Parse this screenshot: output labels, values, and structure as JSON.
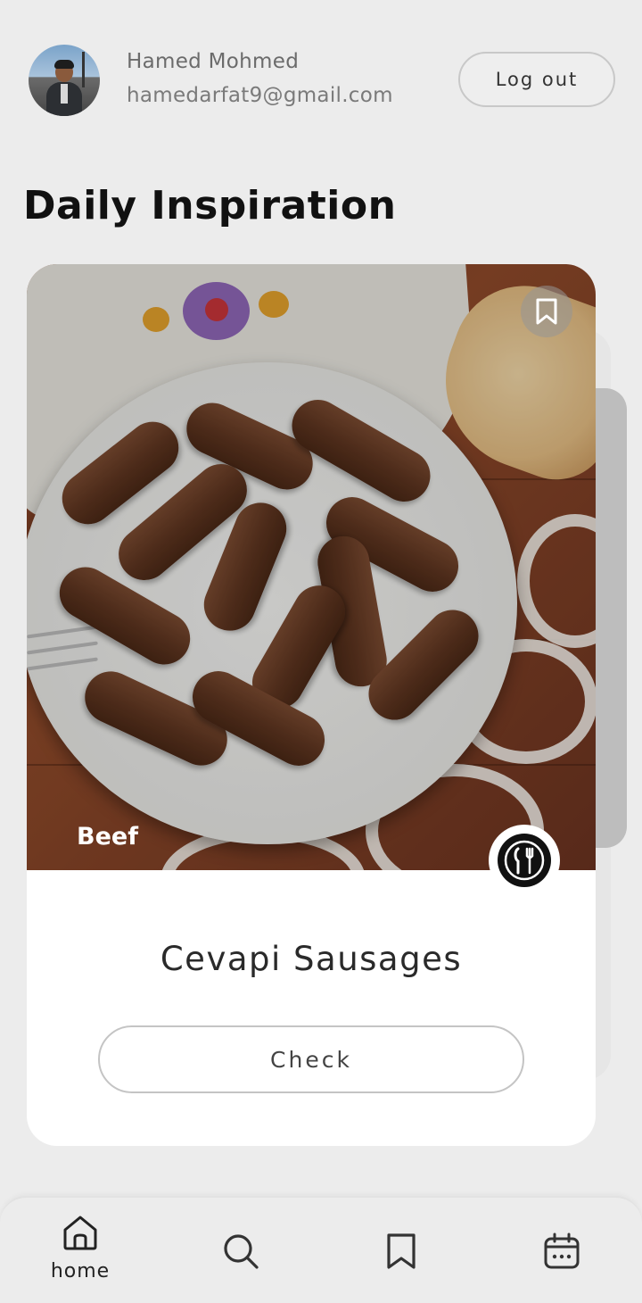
{
  "user": {
    "name": "Hamed Mohmed",
    "email": "hamedarfat9@gmail.com",
    "avatar_icon": "user-avatar-photo"
  },
  "header": {
    "logout_label": "Log out"
  },
  "section": {
    "title": "Daily Inspiration"
  },
  "card": {
    "category": "Beef",
    "recipe_name": "Cevapi Sausages",
    "check_label": "Check",
    "bookmark_icon": "bookmark-icon",
    "cuisine_icon": "fork-knife-icon"
  },
  "nav": {
    "items": [
      {
        "label": "home",
        "icon": "home-icon",
        "active": true
      },
      {
        "label": "",
        "icon": "search-icon",
        "active": false
      },
      {
        "label": "",
        "icon": "bookmark-icon",
        "active": false
      },
      {
        "label": "",
        "icon": "calendar-icon",
        "active": false
      }
    ]
  },
  "colors": {
    "background": "#ececec",
    "card": "#ffffff",
    "text_primary": "#111111",
    "text_muted": "#6b6b6b"
  }
}
